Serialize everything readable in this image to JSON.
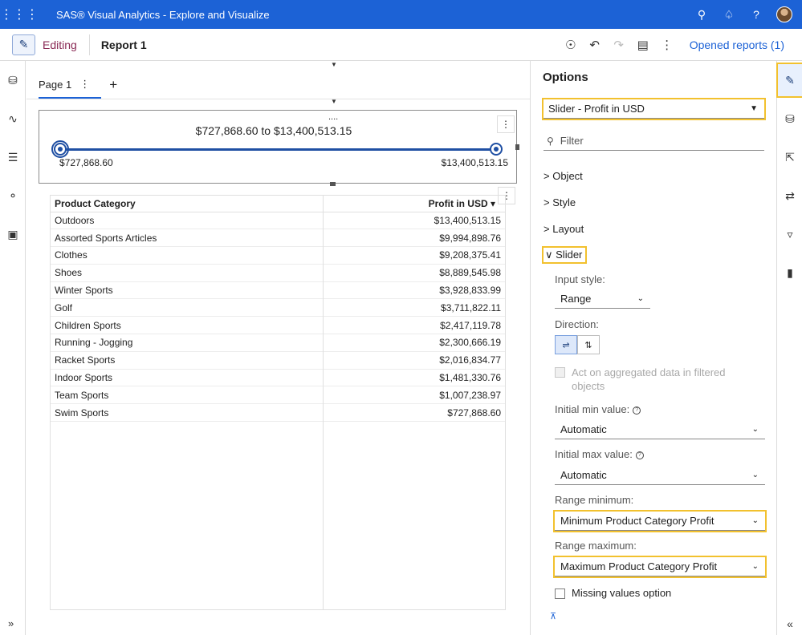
{
  "app": {
    "title": "SAS® Visual Analytics - Explore and Visualize",
    "top_icons": [
      "search-icon",
      "bell-icon",
      "help-icon",
      "avatar"
    ],
    "accent_color": "#1c62d6"
  },
  "toolbar": {
    "editing_label": "Editing",
    "report_title": "Report 1",
    "opened_reports": "Opened reports (1)"
  },
  "canvas": {
    "tabs": [
      {
        "label": "Page 1"
      }
    ],
    "slider": {
      "drag_dots": "....",
      "range_text": "$727,868.60 to $13,400,513.15",
      "min_label": "$727,868.60",
      "max_label": "$13,400,513.15"
    },
    "table": {
      "headers": [
        "Product Category",
        "Profit in USD"
      ],
      "sort_indicator": "▾",
      "rows": [
        [
          "Outdoors",
          "$13,400,513.15"
        ],
        [
          "Assorted Sports Articles",
          "$9,994,898.76"
        ],
        [
          "Clothes",
          "$9,208,375.41"
        ],
        [
          "Shoes",
          "$8,889,545.98"
        ],
        [
          "Winter Sports",
          "$3,928,833.99"
        ],
        [
          "Golf",
          "$3,711,822.11"
        ],
        [
          "Children Sports",
          "$2,417,119.78"
        ],
        [
          "Running - Jogging",
          "$2,300,666.19"
        ],
        [
          "Racket Sports",
          "$2,016,834.77"
        ],
        [
          "Indoor Sports",
          "$1,481,330.76"
        ],
        [
          "Team Sports",
          "$1,007,238.97"
        ],
        [
          "Swim Sports",
          "$727,868.60"
        ]
      ]
    }
  },
  "options": {
    "title": "Options",
    "object_select": "Slider - Profit in USD",
    "filter_placeholder": "Filter",
    "sections": {
      "object": "Object",
      "style": "Style",
      "layout": "Layout",
      "slider": "Slider"
    },
    "input_style_label": "Input style:",
    "input_style_value": "Range",
    "direction_label": "Direction:",
    "act_on_aggregated": "Act on aggregated data in filtered objects",
    "initial_min_label": "Initial min value:",
    "initial_min_value": "Automatic",
    "initial_max_label": "Initial max value:",
    "initial_max_value": "Automatic",
    "range_min_label": "Range minimum:",
    "range_min_value": "Minimum Product Category Profit",
    "range_max_label": "Range maximum:",
    "range_max_value": "Maximum Product Category Profit",
    "missing_values": "Missing values option"
  },
  "highlight_color": "#f2c12e"
}
